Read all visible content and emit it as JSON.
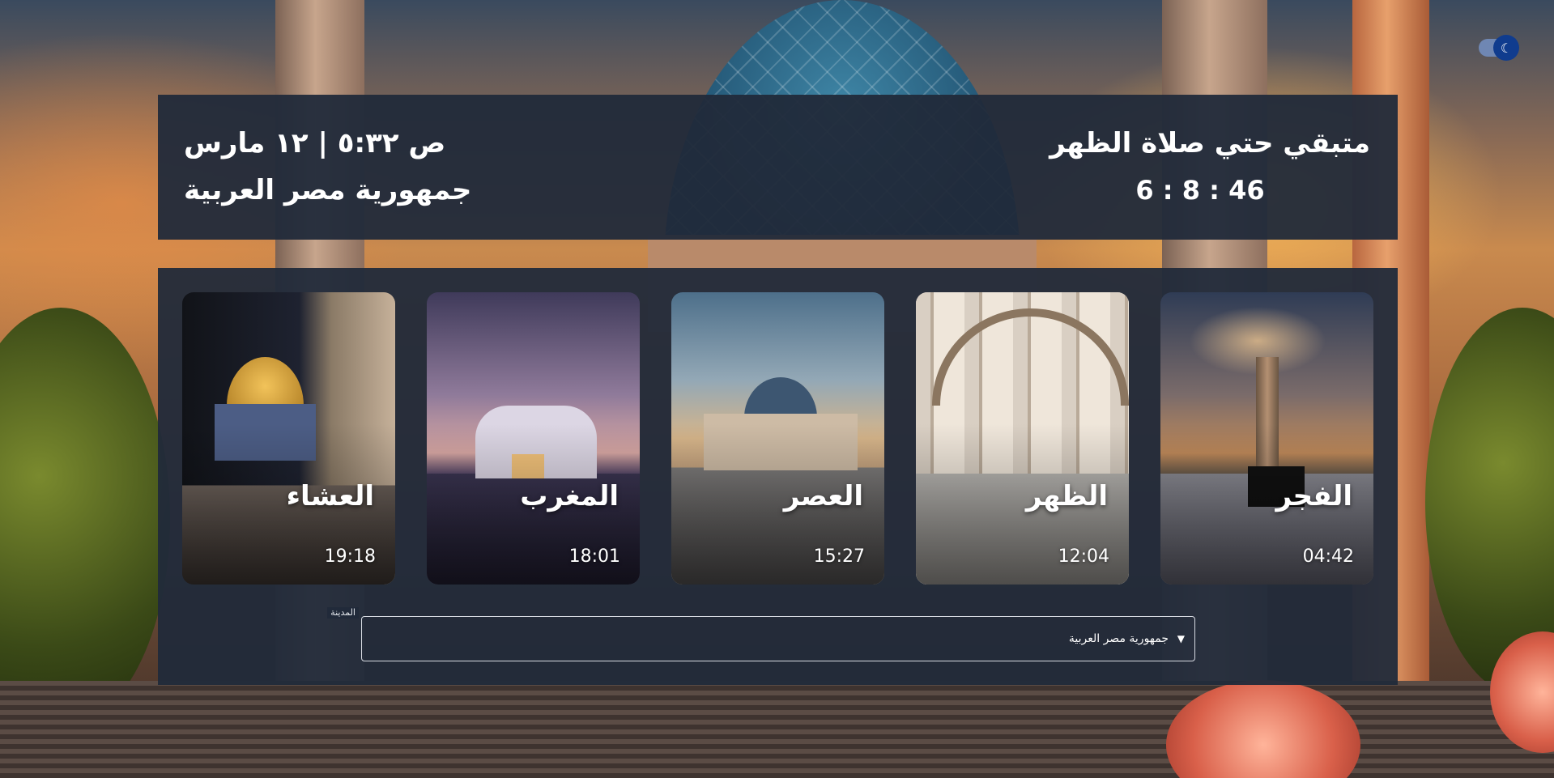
{
  "theme_toggle": {
    "icon": "moon-icon",
    "state": "on",
    "accent_color": "#103c8e"
  },
  "header": {
    "countdown_label": "متبقي حتي صلاة الظهر",
    "countdown_value": "6 : 8 : 46",
    "datetime": "ص ٥:٣٢ | ١٢ مارس",
    "location": "جمهورية مصر العربية"
  },
  "prayers": [
    {
      "name": "الفجر",
      "time": "04:42"
    },
    {
      "name": "الظهر",
      "time": "12:04"
    },
    {
      "name": "العصر",
      "time": "15:27"
    },
    {
      "name": "المغرب",
      "time": "18:01"
    },
    {
      "name": "العشاء",
      "time": "19:18"
    }
  ],
  "city_select": {
    "label": "المدينة",
    "value": "جمهورية مصر العربية",
    "arrow_icon": "caret-down-icon"
  },
  "colors": {
    "panel": "#212a3a",
    "text": "#ffffff"
  }
}
